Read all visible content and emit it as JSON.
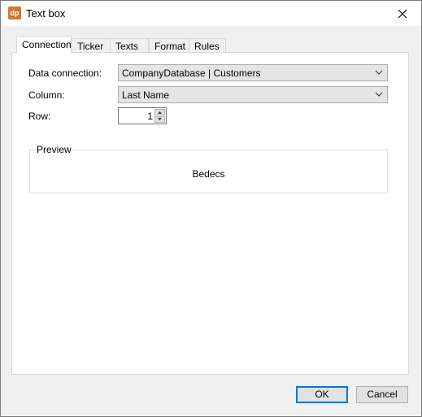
{
  "window": {
    "title": "Text box",
    "app_icon_text": "dp"
  },
  "tabs": [
    {
      "label": "Connection"
    },
    {
      "label": "Ticker"
    },
    {
      "label": "Texts"
    },
    {
      "label": "Format"
    },
    {
      "label": "Rules"
    }
  ],
  "form": {
    "data_connection": {
      "label": "Data connection:",
      "value": "CompanyDatabase | Customers"
    },
    "column": {
      "label": "Column:",
      "value": "Last Name"
    },
    "row": {
      "label": "Row:",
      "value": "1"
    }
  },
  "preview": {
    "title": "Preview",
    "text": "Bedecs"
  },
  "buttons": {
    "ok": "OK",
    "cancel": "Cancel"
  },
  "colors": {
    "app_icon": "#c87a3a",
    "default_button_border": "#0078d7"
  }
}
